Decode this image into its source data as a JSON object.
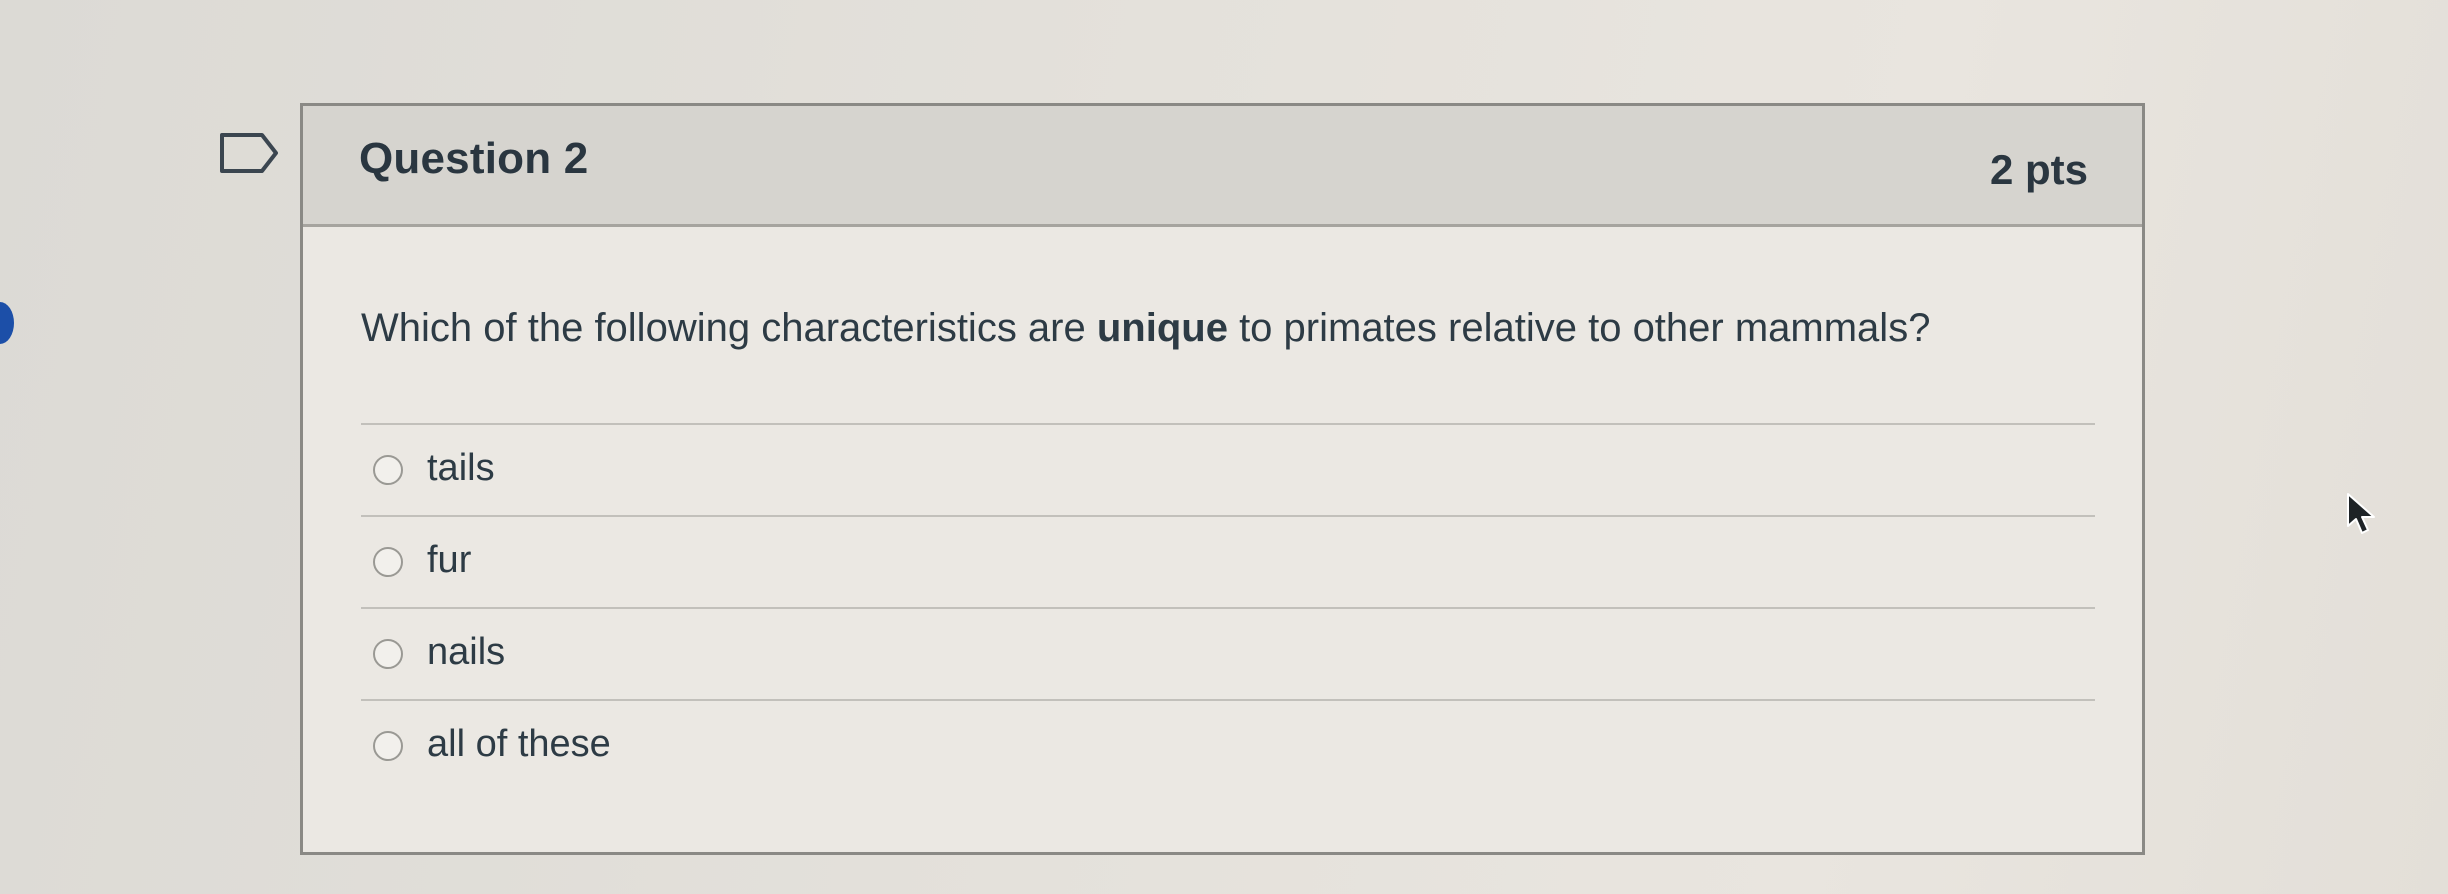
{
  "question": {
    "title": "Question 2",
    "points": "2 pts",
    "text_before": "Which of the following characteristics are ",
    "text_emphasis": "unique",
    "text_after": " to primates relative to other mammals?"
  },
  "answers": [
    {
      "label": "tails"
    },
    {
      "label": "fur"
    },
    {
      "label": "nails"
    },
    {
      "label": "all of these"
    }
  ],
  "icons": {
    "flag": "flag-bookmark-icon",
    "cursor": "mouse-pointer-icon"
  },
  "colors": {
    "header_background": "#d6d4cf",
    "card_background": "#ebe8e3",
    "text": "#2d3b45",
    "left_edge_dot": "#1c4fa8"
  }
}
